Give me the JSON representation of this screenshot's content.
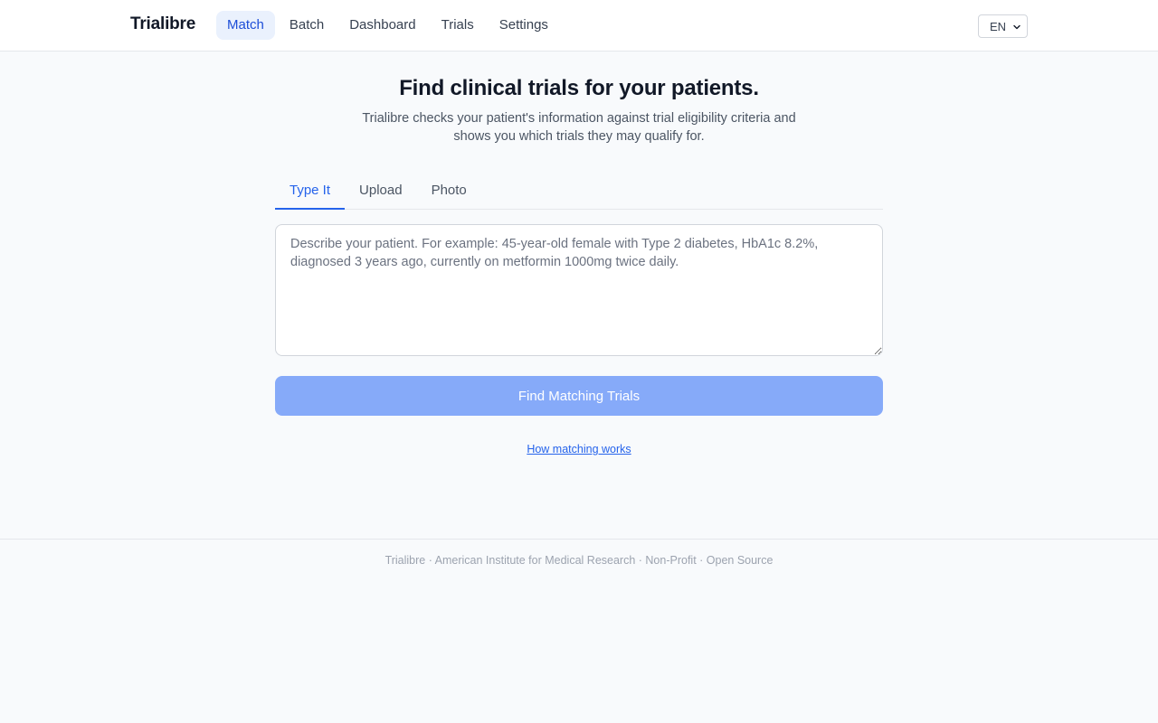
{
  "header": {
    "brand": "Trialibre",
    "nav": [
      {
        "label": "Match",
        "active": true
      },
      {
        "label": "Batch"
      },
      {
        "label": "Dashboard"
      },
      {
        "label": "Trials"
      },
      {
        "label": "Settings"
      }
    ],
    "language": "EN"
  },
  "main": {
    "title": "Find clinical trials for your patients.",
    "subtitle": "Trialibre checks your patient's information against trial eligibility criteria and shows you which trials they may qualify for.",
    "tabs": [
      {
        "label": "Type It",
        "active": true
      },
      {
        "label": "Upload"
      },
      {
        "label": "Photo"
      }
    ],
    "input": {
      "value": "",
      "placeholder": "Describe your patient. For example: 45-year-old female with Type 2 diabetes, HbA1c 8.2%, diagnosed 3 years ago, currently on metformin 1000mg twice daily."
    },
    "submit_label": "Find Matching Trials",
    "help_link": "How matching works"
  },
  "footer": {
    "text": "Trialibre · American Institute for Medical Research · Non-Profit · Open Source"
  },
  "colors": {
    "accent": "#2563eb",
    "button_disabled": "#86aaf9",
    "background": "#f8fafc"
  }
}
